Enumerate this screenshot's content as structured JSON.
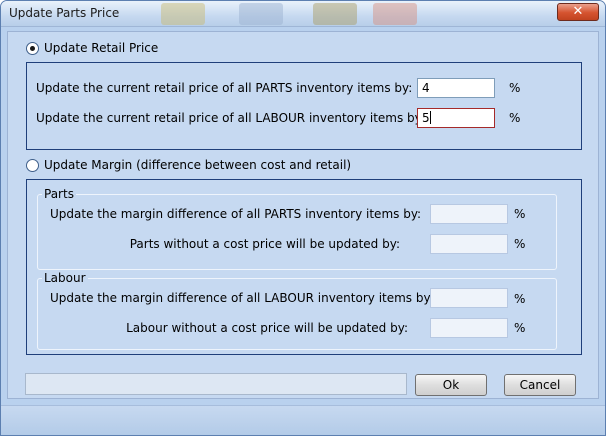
{
  "window": {
    "title": "Update Parts Price",
    "close_label": "✕"
  },
  "retail": {
    "option_label": "Update Retail Price",
    "parts_label": "Update the current retail price of all PARTS inventory items by:",
    "parts_value": "4",
    "labour_label": "Update the current retail price of all LABOUR inventory items by:",
    "labour_value": "5",
    "percent": "%"
  },
  "margin": {
    "option_label": "Update Margin (difference between cost and retail)",
    "parts_group": "Parts",
    "parts_margin_label": "Update the margin difference of all PARTS inventory items by:",
    "parts_nocost_label": "Parts without a cost price will be updated by:",
    "labour_group": "Labour",
    "labour_margin_label": "Update the margin difference of all LABOUR inventory items by:",
    "labour_nocost_label": "Labour without a cost price will be updated by:",
    "percent": "%"
  },
  "buttons": {
    "ok": "Ok",
    "cancel": "Cancel"
  },
  "state": {
    "retail_selected": true,
    "margin_selected": false,
    "progress": 0
  }
}
